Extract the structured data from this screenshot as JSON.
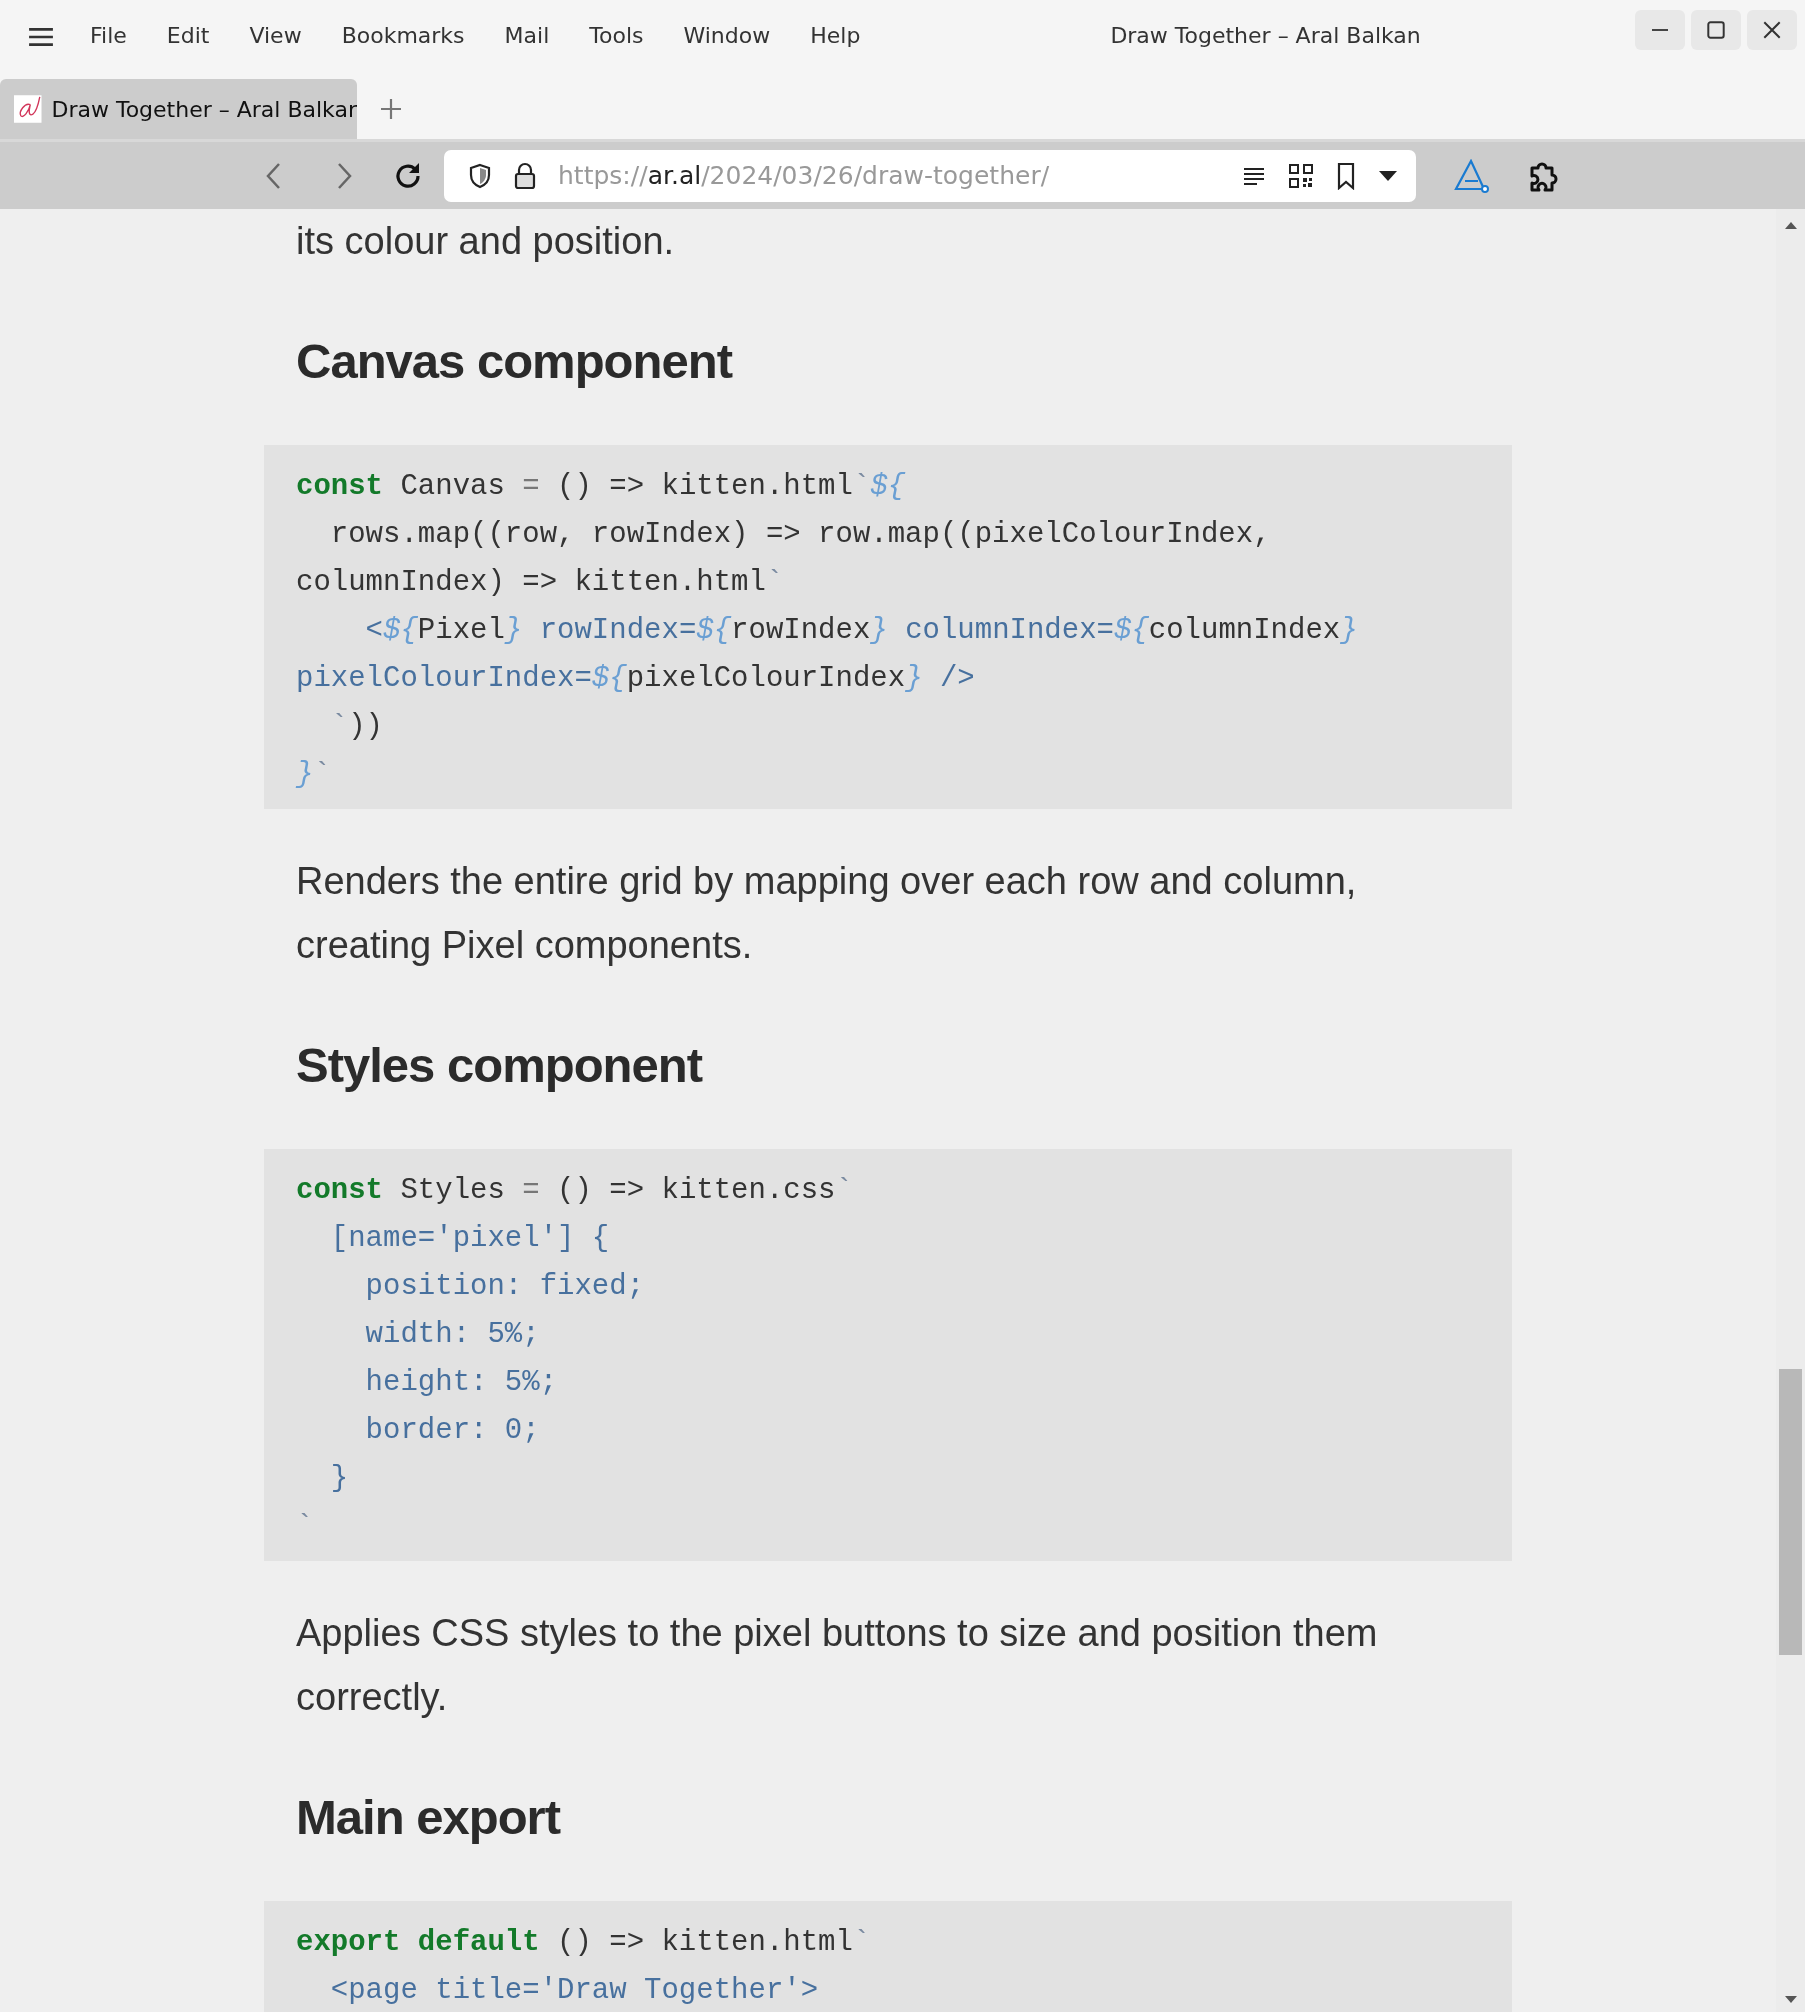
{
  "menu_bar": {
    "items": [
      "File",
      "Edit",
      "View",
      "Bookmarks",
      "Mail",
      "Tools",
      "Window",
      "Help"
    ]
  },
  "window": {
    "title": "Draw Together – Aral Balkan"
  },
  "tabs": [
    {
      "title": "Draw Together – Aral Balkar",
      "selected": true
    }
  ],
  "address_bar": {
    "url_scheme": "https://",
    "url_host": "ar.al",
    "url_path": "/2024/03/26/draw-together/"
  },
  "article": [
    {
      "kind": "paragraph",
      "text": "its colour and position."
    },
    {
      "kind": "heading",
      "text": "Canvas component"
    },
    {
      "kind": "code",
      "lines": [
        [
          {
            "kind": "keyword",
            "text": "const"
          },
          {
            "kind": "plain",
            "text": " Canvas "
          },
          {
            "kind": "op",
            "text": "="
          },
          {
            "kind": "plain",
            "text": " () => kitten.html"
          },
          {
            "kind": "tick",
            "text": "`"
          },
          {
            "kind": "interp",
            "text": "${"
          }
        ],
        [
          {
            "kind": "plain",
            "text": "  rows.map((row, rowIndex) => row.map((pixelColourIndex,"
          }
        ],
        [
          {
            "kind": "plain",
            "text": "columnIndex) => kitten.html"
          },
          {
            "kind": "tick",
            "text": "`"
          }
        ],
        [
          {
            "kind": "attr",
            "text": "    <"
          },
          {
            "kind": "interp",
            "text": "${"
          },
          {
            "kind": "plain",
            "text": "Pixel"
          },
          {
            "kind": "interp",
            "text": "}"
          },
          {
            "kind": "attr",
            "text": " rowIndex="
          },
          {
            "kind": "interp",
            "text": "${"
          },
          {
            "kind": "plain",
            "text": "rowIndex"
          },
          {
            "kind": "interp",
            "text": "}"
          },
          {
            "kind": "attr",
            "text": " columnIndex="
          },
          {
            "kind": "interp",
            "text": "${"
          },
          {
            "kind": "plain",
            "text": "columnIndex"
          },
          {
            "kind": "interp",
            "text": "}"
          }
        ],
        [
          {
            "kind": "attr",
            "text": "pixelColourIndex="
          },
          {
            "kind": "interp",
            "text": "${"
          },
          {
            "kind": "plain",
            "text": "pixelColourIndex"
          },
          {
            "kind": "interp",
            "text": "}"
          },
          {
            "kind": "attr",
            "text": " />"
          }
        ],
        [
          {
            "kind": "tick",
            "text": "  `"
          },
          {
            "kind": "plain",
            "text": "))"
          }
        ],
        [
          {
            "kind": "interp",
            "text": "}"
          },
          {
            "kind": "tick",
            "text": "`"
          }
        ]
      ]
    },
    {
      "kind": "paragraph",
      "text": "Renders the entire grid by mapping over each row and column, creating Pixel components."
    },
    {
      "kind": "heading",
      "text": "Styles component"
    },
    {
      "kind": "code",
      "lines": [
        [
          {
            "kind": "keyword",
            "text": "const"
          },
          {
            "kind": "plain",
            "text": " Styles "
          },
          {
            "kind": "op",
            "text": "="
          },
          {
            "kind": "plain",
            "text": " () => kitten.css"
          },
          {
            "kind": "tick",
            "text": "`"
          }
        ],
        [
          {
            "kind": "attr",
            "text": "  [name='pixel'] {"
          }
        ],
        [
          {
            "kind": "attr",
            "text": "    position: fixed;"
          }
        ],
        [
          {
            "kind": "attr",
            "text": "    width: 5%;"
          }
        ],
        [
          {
            "kind": "attr",
            "text": "    height: 5%;"
          }
        ],
        [
          {
            "kind": "attr",
            "text": "    border: 0;"
          }
        ],
        [
          {
            "kind": "attr",
            "text": "  }"
          }
        ],
        [
          {
            "kind": "tick",
            "text": "`"
          }
        ]
      ]
    },
    {
      "kind": "paragraph",
      "text": "Applies CSS styles to the pixel buttons to size and position them correctly."
    },
    {
      "kind": "heading",
      "text": "Main export"
    },
    {
      "kind": "code",
      "lines": [
        [
          {
            "kind": "keyword",
            "text": "export default"
          },
          {
            "kind": "plain",
            "text": " () => kitten.html"
          },
          {
            "kind": "tick",
            "text": "`"
          }
        ],
        [
          {
            "kind": "attr",
            "text": "  <page title='Draw Together'>"
          }
        ]
      ]
    }
  ]
}
